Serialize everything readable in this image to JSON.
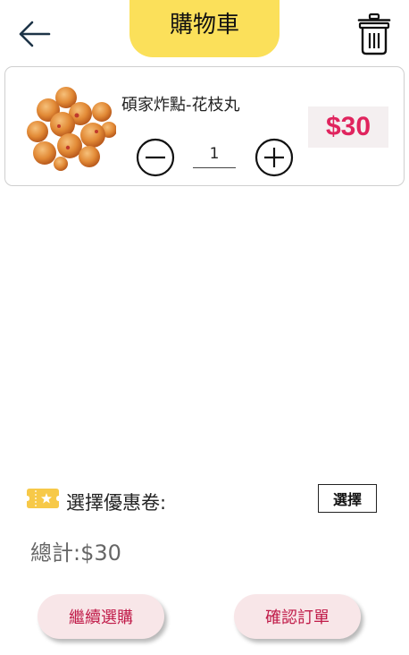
{
  "header": {
    "title": "購物車",
    "back_icon": "arrow-left-icon",
    "delete_icon": "trash-icon",
    "accent_color": "#fbe05a"
  },
  "cart": {
    "items": [
      {
        "name": "碩家炸點-花枝丸",
        "quantity": "1",
        "price": "$30",
        "image_icon": "fried-squid-balls-photo"
      }
    ]
  },
  "coupon": {
    "label": "選擇優惠卷:",
    "button_label": "選擇",
    "icon": "coupon-ticket-icon"
  },
  "summary": {
    "total": "總計:$30"
  },
  "actions": {
    "continue_label": "繼續選購",
    "confirm_label": "確認訂單"
  },
  "colors": {
    "price": "#e0245e",
    "button_text": "#c01a48",
    "button_bg": "#f8e6e8"
  }
}
